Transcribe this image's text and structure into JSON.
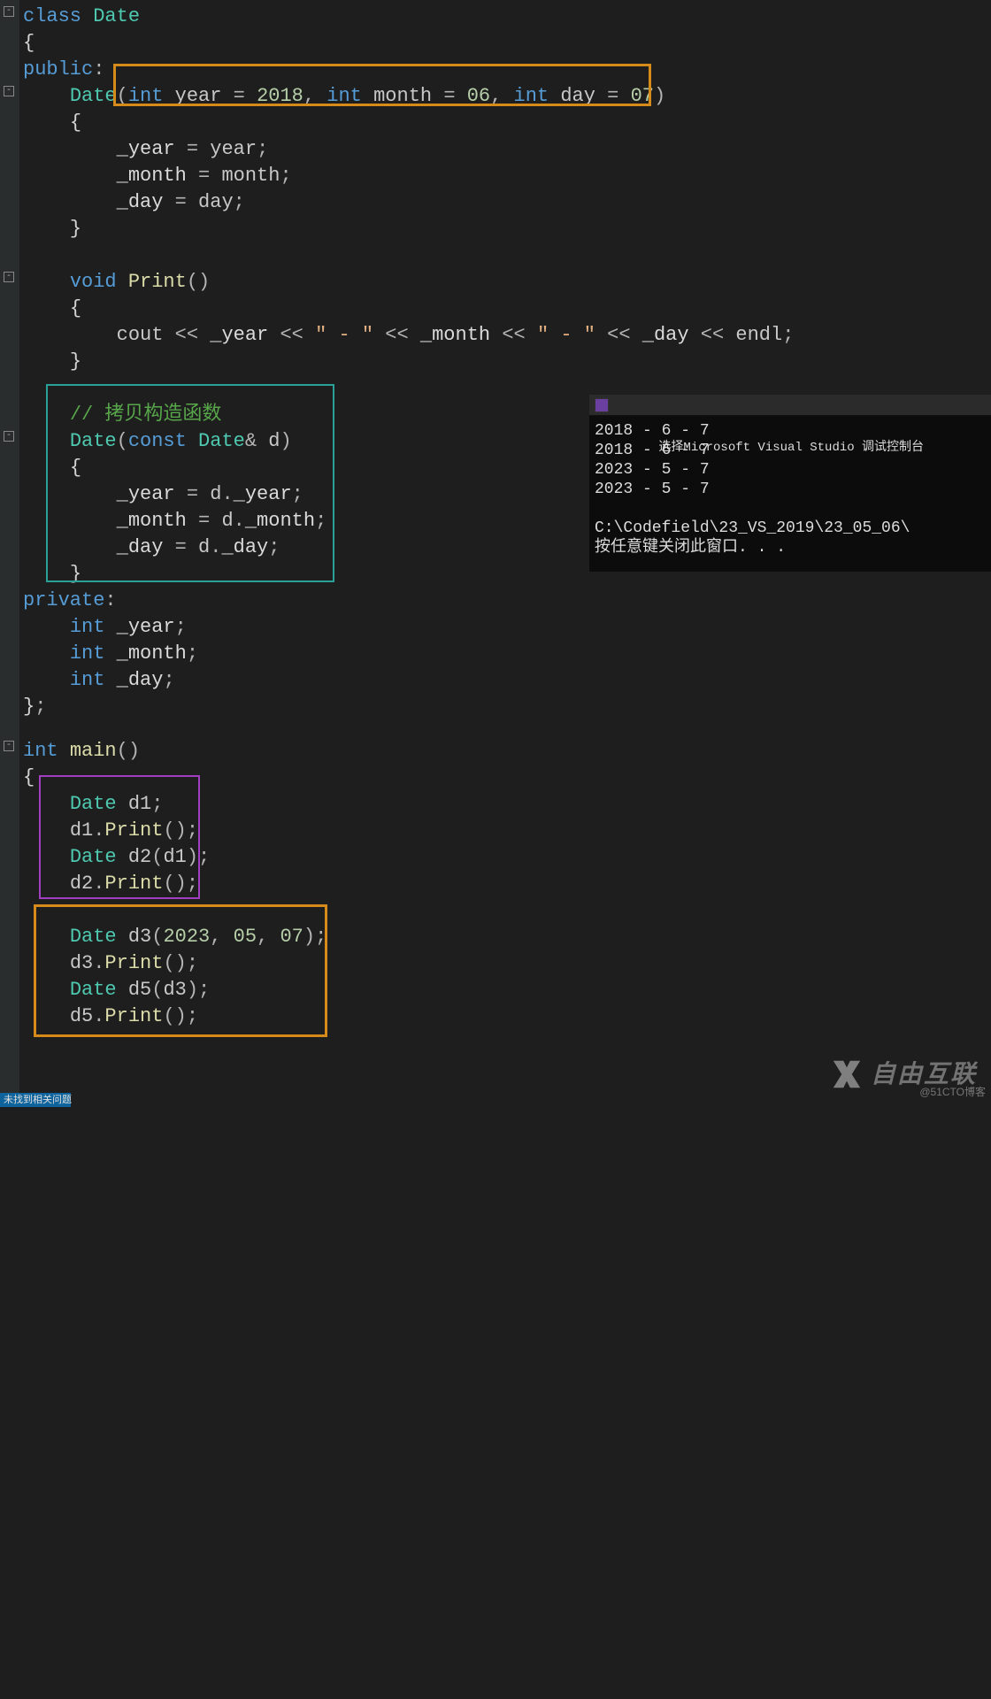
{
  "code": {
    "l1": "class Date",
    "l2": "{",
    "l3": "public:",
    "l4a": "    Date(",
    "l4b": "int year = 2018, int month = 06, int day = 07",
    "l4c": ")",
    "l5": "    {",
    "l6": "        _year = year;",
    "l7": "        _month = month;",
    "l8": "        _day = day;",
    "l9": "    }",
    "l10": "",
    "l11": "    void Print()",
    "l12": "    {",
    "l13": "        cout << _year << \" - \" << _month << \" - \" << _day << endl;",
    "l14": "    }",
    "l15": "",
    "l16": "    // 拷贝构造函数",
    "l17": "    Date(const Date& d)",
    "l18": "    {",
    "l19": "        _year = d._year;",
    "l20": "        _month = d._month;",
    "l21": "        _day = d._day;",
    "l22": "    }",
    "l23": "private:",
    "l24": "    int _year;",
    "l25": "    int _month;",
    "l26": "    int _day;",
    "l27": "};",
    "l28": "",
    "l29": "int main()",
    "l30": "{",
    "l31": "    Date d1;",
    "l32": "    d1.Print();",
    "l33": "    Date d2(d1);",
    "l34": "    d2.Print();",
    "l35": "",
    "l36": "    Date d3(2023, 05, 07);",
    "l37": "    d3.Print();",
    "l38": "    Date d5(d3);",
    "l39": "    d5.Print();"
  },
  "console": {
    "title": "选择Microsoft Visual Studio 调试控制台",
    "lines": [
      "2018 - 6 - 7",
      "2018 - 6 - 7",
      "2023 - 5 - 7",
      "2023 - 5 - 7"
    ],
    "path": "C:\\Codefield\\23_VS_2019\\23_05_06\\",
    "prompt": "按任意键关闭此窗口. . ."
  },
  "watermark": {
    "text": "自由互联",
    "sub": "@51CTO博客"
  },
  "status": "未找到相关问题"
}
